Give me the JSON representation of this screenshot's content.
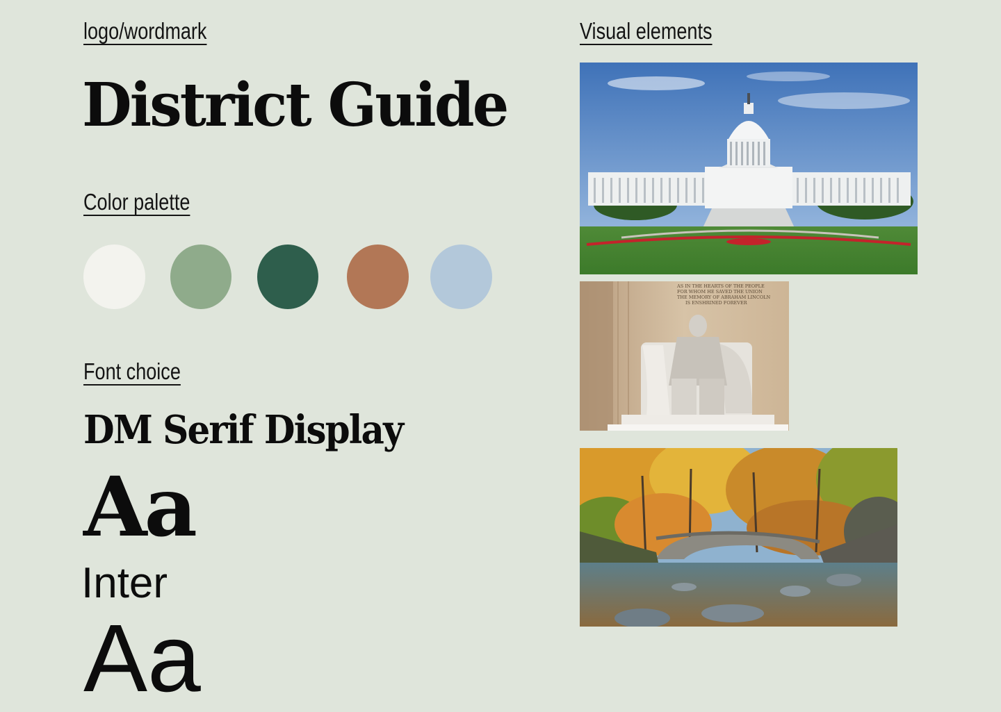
{
  "sections": {
    "logo_label": "logo/wordmark",
    "palette_label": "Color palette",
    "font_label": "Font choice",
    "visual_label": "Visual elements"
  },
  "wordmark": "District Guide",
  "palette": {
    "colors": [
      "#f3f3ee",
      "#8fab8b",
      "#2e5e4c",
      "#b27756",
      "#b3c8da"
    ]
  },
  "fonts": {
    "primary_name": "DM Serif Display",
    "primary_sample": "Aa",
    "secondary_name": "Inter",
    "secondary_sample": "Aa"
  },
  "photos": [
    {
      "subject": "capitol-building"
    },
    {
      "subject": "lincoln-memorial-statue"
    },
    {
      "subject": "autumn-stone-bridge"
    }
  ],
  "memorial_inscription": [
    "AS IN THE HEARTS OF THE PEOPLE",
    "FOR WHOM HE SAVED THE UNION",
    "THE MEMORY OF ABRAHAM LINCOLN",
    "IS ENSHRINED FOREVER"
  ]
}
